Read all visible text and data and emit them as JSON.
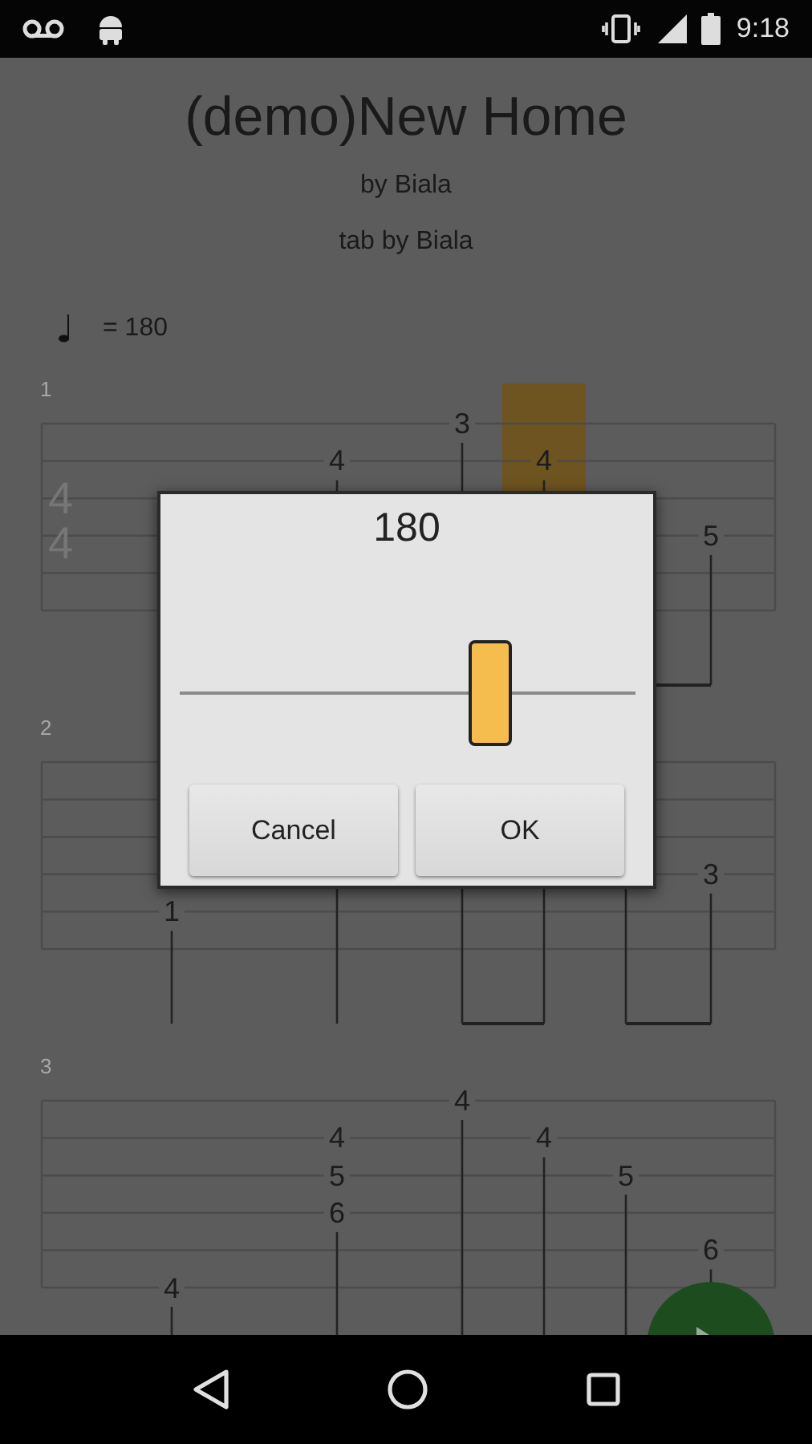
{
  "status_bar": {
    "time": "9:18"
  },
  "song": {
    "title": "(demo)New Home",
    "artist": "by Biala",
    "tab_author": "tab by Biala",
    "tempo": "= 180"
  },
  "measures": [
    {
      "number": "1",
      "time_signature": [
        "4",
        "4"
      ],
      "beats": {
        "beat_2": {
          "notes": {
            "B": "4"
          },
          "highlighted": false
        },
        "beat_3": {
          "notes": {
            "e": "3"
          },
          "highlighted": false
        },
        "beat_4": {
          "notes": {
            "B": "4"
          },
          "highlighted": true
        },
        "beat_6": {
          "notes": {
            "D": "5"
          },
          "highlighted": false
        }
      }
    },
    {
      "number": "2",
      "beats": {
        "beat_1": {
          "notes": {
            "A": "1"
          },
          "highlighted": false
        },
        "beat_6": {
          "notes": {
            "D": "3"
          },
          "highlighted": false
        }
      }
    },
    {
      "number": "3",
      "beats": {
        "beat_1": {
          "notes": {
            "E": "4"
          },
          "highlighted": false
        },
        "beat_2": {
          "notes": {
            "B": "4",
            "G": "5",
            "D": "6"
          },
          "highlighted": false
        },
        "beat_3": {
          "notes": {
            "e": "4"
          },
          "highlighted": false
        },
        "beat_4": {
          "notes": {
            "B": "4"
          },
          "highlighted": false
        },
        "beat_5": {
          "notes": {
            "G": "5"
          },
          "highlighted": false
        },
        "beat_6": {
          "notes": {
            "A": "6"
          },
          "highlighted": false
        }
      }
    }
  ],
  "dialog": {
    "value": "180",
    "slider": {
      "level": 0.68
    },
    "buttons": [
      "Cancel",
      "OK"
    ]
  }
}
